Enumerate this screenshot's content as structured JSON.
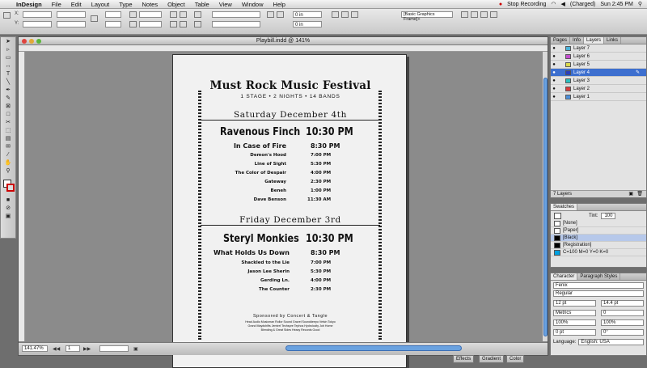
{
  "menubar": {
    "app": "InDesign",
    "items": [
      "File",
      "Edit",
      "Layout",
      "Type",
      "Notes",
      "Object",
      "Table",
      "View",
      "Window",
      "Help"
    ],
    "recording": "Stop Recording",
    "status": "(Charged)",
    "clock": "Sun 2:45 PM"
  },
  "control": {
    "ref_x": "0 in",
    "ref_y": "0 in",
    "style_field": "[Basic Graphics Frame]+"
  },
  "document": {
    "title": "Playbill.indd @ 141%",
    "zoom": "141.47%",
    "page": "1"
  },
  "poster": {
    "title": "Must Rock Music Festival",
    "subtitle": "1 STAGE  •  2 NIGHTS  •  14 BANDS",
    "nights": [
      {
        "heading": "Saturday December 4th",
        "headliner": {
          "band": "Ravenous Finch",
          "time": "10:30 PM"
        },
        "acts": [
          {
            "band": "In Case of Fire",
            "time": "8:30 PM"
          },
          {
            "band": "Demon's Hood",
            "time": "7:00 PM"
          },
          {
            "band": "Line of Sight",
            "time": "5:30 PM"
          },
          {
            "band": "The Color of Despair",
            "time": "4:00 PM"
          },
          {
            "band": "Gateway",
            "time": "2:30 PM"
          },
          {
            "band": "Beneh",
            "time": "1:00 PM"
          },
          {
            "band": "Dave Benson",
            "time": "11:30 AM"
          }
        ]
      },
      {
        "heading": "Friday December 3rd",
        "headliner": {
          "band": "Steryl Monkies",
          "time": "10:30 PM"
        },
        "acts": [
          {
            "band": "What Holds Us Down",
            "time": "8:30 PM"
          },
          {
            "band": "Shackled to the Lie",
            "time": "7:00 PM"
          },
          {
            "band": "Jason Lee Sherin",
            "time": "5:30 PM"
          },
          {
            "band": "Gerding Ln.",
            "time": "4:00 PM"
          },
          {
            "band": "The Counter",
            "time": "2:30 PM"
          }
        ]
      }
    ],
    "footer": [
      "Sponsored by Concert & Tangle",
      "Head Audio Musicman Rollor Sound Gravel Sounddeepo Velsin Tokyo",
      "Grand Maydshifts Jemirel Techspre Tephos Hydrolocity Job Home",
      "Blending & Great Sides Heavy Records Good"
    ]
  },
  "layers_panel": {
    "tabs": [
      "Pages",
      "Info",
      "Layers",
      "Links"
    ],
    "layers": [
      {
        "name": "Layer 7",
        "color": "#4db3d9"
      },
      {
        "name": "Layer 6",
        "color": "#c44dcf"
      },
      {
        "name": "Layer 5",
        "color": "#d9d94d"
      },
      {
        "name": "Layer 4",
        "color": "#2a3fbf"
      },
      {
        "name": "Layer 3",
        "color": "#2bbfbf"
      },
      {
        "name": "Layer 2",
        "color": "#d93b3b"
      },
      {
        "name": "Layer 1",
        "color": "#4d8fd9"
      }
    ],
    "footer": "7 Layers"
  },
  "swatches_panel": {
    "tab": "Swatches",
    "tint_label": "Tint:",
    "tint_value": "100",
    "swatches": [
      {
        "name": "[None]",
        "color": "#ffffff"
      },
      {
        "name": "[Paper]",
        "color": "#ffffff"
      },
      {
        "name": "[Black]",
        "color": "#000000"
      },
      {
        "name": "[Registration]",
        "color": "#000000"
      },
      {
        "name": "C=100 M=0 Y=0 K=0",
        "color": "#00a0e0"
      }
    ]
  },
  "character_panel": {
    "tabs": [
      "Character",
      "Paragraph Styles"
    ],
    "font": "Fenix",
    "style": "Regular",
    "size": "12 pt",
    "leading": "14.4 pt",
    "kerning": "Metrics",
    "tracking": "0",
    "vscale": "100%",
    "hscale": "100%",
    "baseline": "0 pt",
    "skew": "0°",
    "language_label": "Language:",
    "language": "English: USA"
  },
  "dock_tabs": [
    "Effects",
    "Gradient",
    "Color"
  ]
}
